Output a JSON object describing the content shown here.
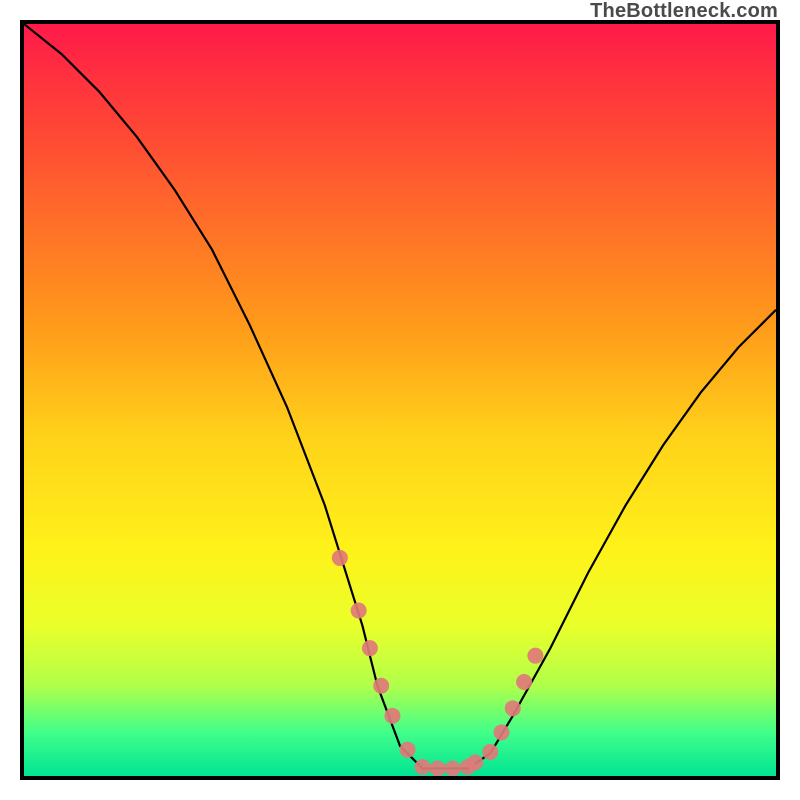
{
  "watermark": "TheBottleneck.com",
  "chart_data": {
    "type": "line",
    "title": "",
    "xlabel": "",
    "ylabel": "",
    "xlim": [
      0,
      100
    ],
    "ylim": [
      0,
      100
    ],
    "grid": false,
    "curve": {
      "name": "bottleneck-curve",
      "x": [
        0,
        5,
        10,
        15,
        20,
        25,
        30,
        35,
        40,
        45,
        47,
        50,
        53,
        56,
        59,
        62,
        65,
        70,
        75,
        80,
        85,
        90,
        95,
        100
      ],
      "y": [
        100,
        96,
        91,
        85,
        78,
        70,
        60,
        49,
        36,
        20,
        12,
        4,
        1,
        1,
        1,
        3,
        8,
        17,
        27,
        36,
        44,
        51,
        57,
        62
      ]
    },
    "markers": {
      "name": "highlighted-points",
      "x": [
        42,
        44.5,
        46,
        47.5,
        49,
        51,
        53,
        55,
        57,
        59,
        60,
        62,
        63.5,
        65,
        66.5,
        68
      ],
      "y": [
        29,
        22,
        17,
        12,
        8,
        3.5,
        1.2,
        1,
        1,
        1.2,
        1.8,
        3.2,
        5.8,
        9,
        12.5,
        16
      ],
      "r": [
        8,
        8,
        8,
        8,
        8,
        8,
        8,
        8,
        8,
        8,
        8,
        8,
        8,
        8,
        8,
        8
      ]
    }
  }
}
